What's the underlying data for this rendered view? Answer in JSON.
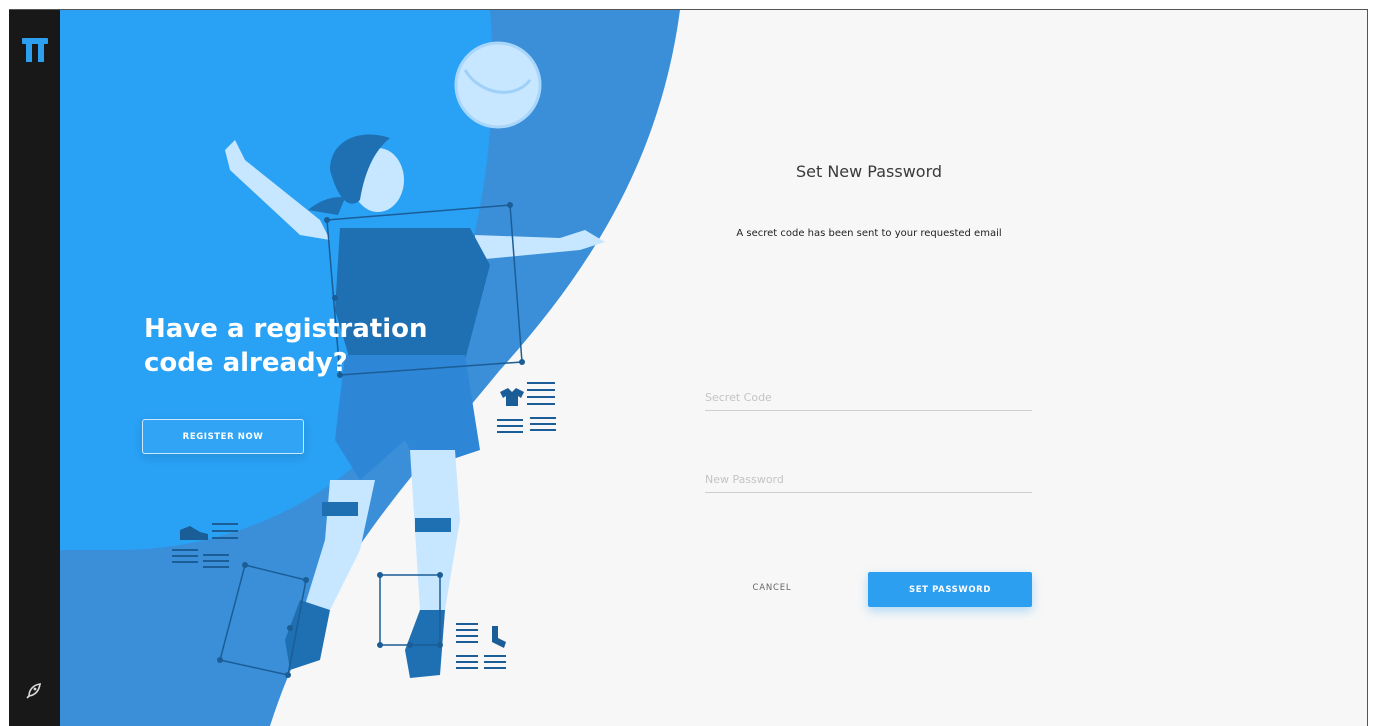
{
  "sidebar": {
    "logo_icon": "tt-logo-icon",
    "bottom_icon": "rocket-icon"
  },
  "hero": {
    "title": "Have a registration code already?",
    "register_label": "REGISTER NOW"
  },
  "form": {
    "title": "Set New Password",
    "subtitle": "A secret code has been sent to your requested email",
    "secret_code_placeholder": "Secret Code",
    "secret_code_value": "",
    "new_password_placeholder": "New Password",
    "new_password_value": "",
    "cancel_label": "CANCEL",
    "submit_label": "SET PASSWORD"
  },
  "colors": {
    "sidebar_bg": "#181818",
    "hero_primary": "#29a1f5",
    "hero_secondary": "#3a8fd8",
    "hero_dark": "#1f6fb3",
    "accent_button": "#2d9ff0",
    "panel_bg": "#f7f7f7"
  }
}
